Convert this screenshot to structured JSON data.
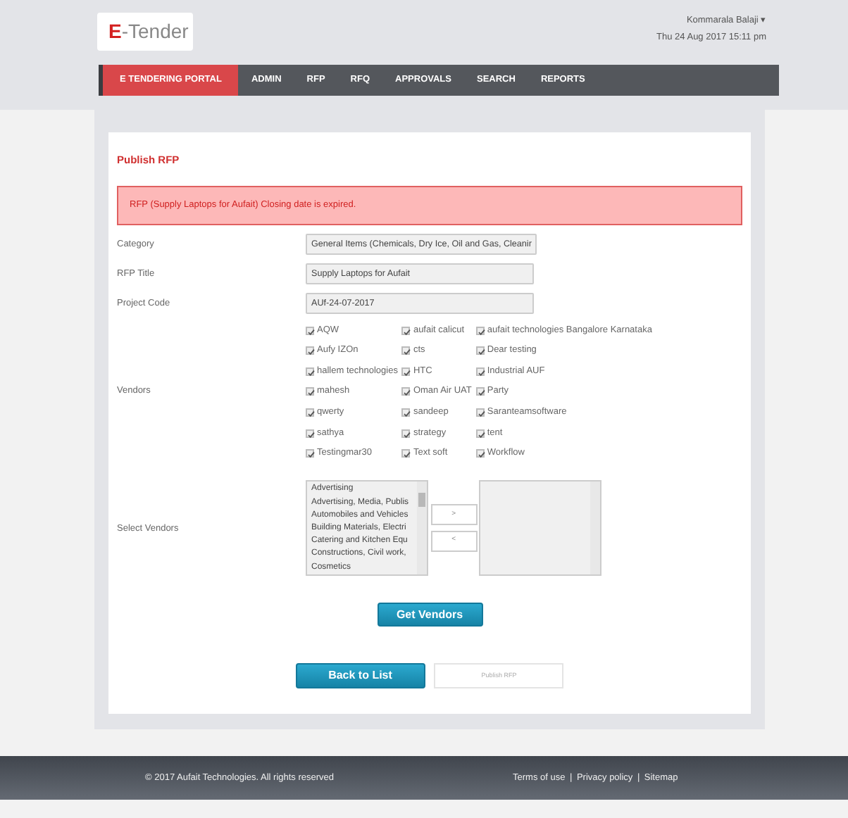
{
  "logo": {
    "mark": "E",
    "text": "-Tender"
  },
  "user": {
    "name": "Kommarala Balaji",
    "caret": "▾",
    "datetime": "Thu 24 Aug 2017 15:11 pm"
  },
  "nav": [
    {
      "label": "E TENDERING PORTAL",
      "selected": true
    },
    {
      "label": "ADMIN",
      "selected": false
    },
    {
      "label": "RFP",
      "selected": false
    },
    {
      "label": "RFQ",
      "selected": false
    },
    {
      "label": "APPROVALS",
      "selected": false
    },
    {
      "label": "SEARCH",
      "selected": false
    },
    {
      "label": "REPORTS",
      "selected": false
    }
  ],
  "panel_title": "Publish RFP",
  "alert": "RFP (Supply Laptops for Aufait) Closing date is expired.",
  "fields": [
    {
      "label": "Category",
      "value": "General Items (Chemicals, Dry Ice, Oil and Gas, Cleanir"
    },
    {
      "label": "RFP Title",
      "value": "Supply Laptops for Aufait"
    },
    {
      "label": "Project Code",
      "value": "AUf-24-07-2017"
    }
  ],
  "vendors_label": "Vendors",
  "vendors": [
    {
      "name": "AQW",
      "checked": true
    },
    {
      "name": "aufait calicut",
      "checked": true
    },
    {
      "name": "aufait technologies Bangalore Karnataka",
      "checked": true
    },
    {
      "name": "Aufy IZOn",
      "checked": true
    },
    {
      "name": "cts",
      "checked": true
    },
    {
      "name": "Dear testing",
      "checked": true
    },
    {
      "name": "hallem technologies",
      "checked": true
    },
    {
      "name": "HTC",
      "checked": true
    },
    {
      "name": "Industrial AUF",
      "checked": true
    },
    {
      "name": "mahesh",
      "checked": true
    },
    {
      "name": "Oman Air UAT",
      "checked": true
    },
    {
      "name": "Party",
      "checked": true
    },
    {
      "name": "qwerty",
      "checked": true
    },
    {
      "name": "sandeep",
      "checked": true
    },
    {
      "name": "Saranteamsoftware",
      "checked": true
    },
    {
      "name": "sathya",
      "checked": true
    },
    {
      "name": "strategy",
      "checked": true
    },
    {
      "name": "tent",
      "checked": true
    },
    {
      "name": "Testingmar30",
      "checked": true
    },
    {
      "name": "Text soft",
      "checked": true
    },
    {
      "name": "Workflow",
      "checked": true
    }
  ],
  "select_vendors": {
    "label": "Select Vendors",
    "options": [
      "Advertising",
      "Advertising, Media, Publis",
      "Automobiles and Vehicles",
      "Building Materials, Electri",
      "Catering and Kitchen Equ",
      "Constructions, Civil work,",
      "Cosmetics"
    ],
    "move_buttons": [
      ">",
      "<"
    ]
  },
  "get_vendors": "Get Vendors",
  "actions": [
    {
      "label": "Back to List",
      "disabled": false
    },
    {
      "label": "Publish RFP",
      "disabled": true
    }
  ],
  "footer": {
    "copyright": "© 2017 Aufait Technologies. All rights reserved",
    "links": [
      "Terms of use",
      "Privacy policy",
      "Sitemap"
    ],
    "separator": "|"
  }
}
